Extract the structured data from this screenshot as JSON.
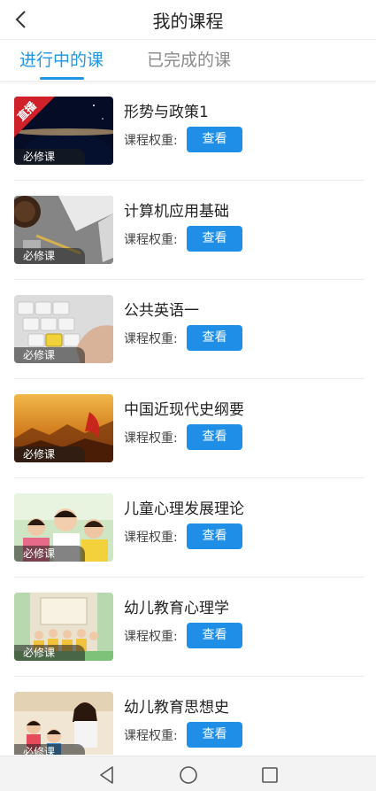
{
  "header": {
    "title": "我的课程",
    "back_icon": "chevron-left-icon"
  },
  "tabs": [
    {
      "label": "进行中的课",
      "active": true
    },
    {
      "label": "已完成的课",
      "active": false
    }
  ],
  "courses": [
    {
      "title": "形势与政策1",
      "tag": "必修课",
      "weight_label": "课程权重:",
      "button": "查看",
      "badge": "直播",
      "thumb": "earth-globe"
    },
    {
      "title": "计算机应用基础",
      "tag": "必修课",
      "weight_label": "课程权重:",
      "button": "查看",
      "thumb": "desk-keyboard"
    },
    {
      "title": "公共英语一",
      "tag": "必修课",
      "weight_label": "课程权重:",
      "button": "查看",
      "thumb": "keyboard-finger"
    },
    {
      "title": "中国近现代史纲要",
      "tag": "必修课",
      "weight_label": "课程权重:",
      "button": "查看",
      "thumb": "great-wall"
    },
    {
      "title": "儿童心理发展理论",
      "tag": "必修课",
      "weight_label": "课程权重:",
      "button": "查看",
      "thumb": "children"
    },
    {
      "title": "幼儿教育心理学",
      "tag": "必修课",
      "weight_label": "课程权重:",
      "button": "查看",
      "thumb": "classroom"
    },
    {
      "title": "幼儿教育思想史",
      "tag": "必修课",
      "weight_label": "课程权重:",
      "button": "查看",
      "thumb": "teacher-kids"
    }
  ],
  "system_nav": {
    "back": "triangle-back-icon",
    "home": "circle-home-icon",
    "recent": "square-recent-icon"
  },
  "colors": {
    "accent": "#1f95e8",
    "button": "#1e8ee6",
    "live_badge": "#d0212a"
  }
}
